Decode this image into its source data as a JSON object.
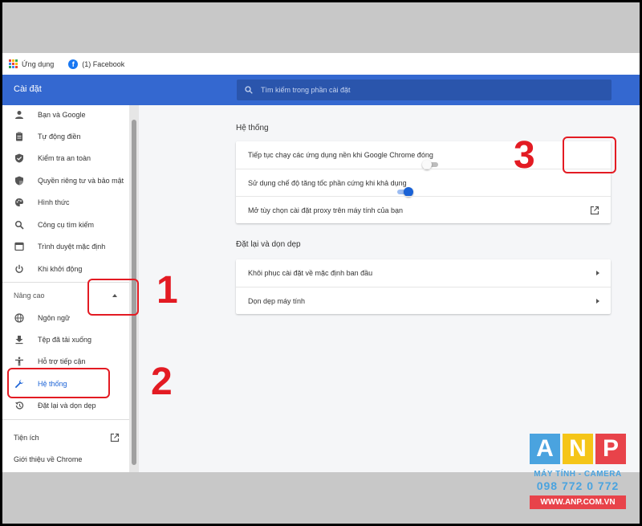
{
  "bookmarks": {
    "apps_label": "Ứng dụng",
    "facebook_label": "(1) Facebook",
    "apps_dot_colors": [
      "#ea4335",
      "#fbbc05",
      "#34a853",
      "#4285f4",
      "#ea4335",
      "#fbbc05",
      "#34a853",
      "#4285f4",
      "#ea4335"
    ]
  },
  "header": {
    "title": "Cài đặt",
    "search_placeholder": "Tìm kiếm trong phần cài đặt"
  },
  "sidebar": {
    "items": [
      {
        "label": "Bạn và Google",
        "icon": "person-icon"
      },
      {
        "label": "Tự động điền",
        "icon": "clipboard-icon"
      },
      {
        "label": "Kiểm tra an toàn",
        "icon": "shield-check-icon"
      },
      {
        "label": "Quyền riêng tư và bảo mật",
        "icon": "shield-lock-icon"
      },
      {
        "label": "Hình thức",
        "icon": "palette-icon"
      },
      {
        "label": "Công cụ tìm kiếm",
        "icon": "search-icon"
      },
      {
        "label": "Trình duyệt mặc định",
        "icon": "browser-icon"
      },
      {
        "label": "Khi khởi động",
        "icon": "power-icon"
      }
    ],
    "advanced_label": "Nâng cao",
    "advanced_items": [
      {
        "label": "Ngôn ngữ",
        "icon": "globe-icon"
      },
      {
        "label": "Tệp đã tải xuống",
        "icon": "download-icon"
      },
      {
        "label": "Hỗ trợ tiếp cận",
        "icon": "accessibility-icon"
      },
      {
        "label": "Hệ thống",
        "icon": "wrench-icon",
        "active": true
      },
      {
        "label": "Đặt lại và dọn dẹp",
        "icon": "restore-icon"
      }
    ],
    "extensions_label": "Tiện ích",
    "about_label": "Giới thiệu về Chrome"
  },
  "main": {
    "system": {
      "title": "Hệ thống",
      "rows": [
        {
          "label": "Tiếp tục chạy các ứng dụng nền khi Google Chrome đóng",
          "control": "toggle",
          "state": "off"
        },
        {
          "label": "Sử dụng chế độ tăng tốc phần cứng khi khả dụng",
          "control": "toggle",
          "state": "on"
        },
        {
          "label": "Mở tùy chọn cài đặt proxy trên máy tính của bạn",
          "control": "external-link"
        }
      ]
    },
    "reset": {
      "title": "Đặt lại và dọn dẹp",
      "rows": [
        {
          "label": "Khôi phục cài đặt về mặc định ban đầu"
        },
        {
          "label": "Dọn dẹp máy tính"
        }
      ]
    }
  },
  "annotations": {
    "num1": "1",
    "num2": "2",
    "num3": "3",
    "color": "#e31b23"
  },
  "logo": {
    "letters": [
      "A",
      "N",
      "P"
    ],
    "letter_colors": [
      "#4aa3df",
      "#f5c518",
      "#e8434a"
    ],
    "line1": "MÁY TÍNH - CAMERA",
    "phone": "098 772 0 772",
    "website": "WWW.ANP.COM.VN"
  },
  "colors": {
    "header_bg": "#3468d0",
    "accent": "#1a62d6",
    "annotation": "#e31b23"
  }
}
